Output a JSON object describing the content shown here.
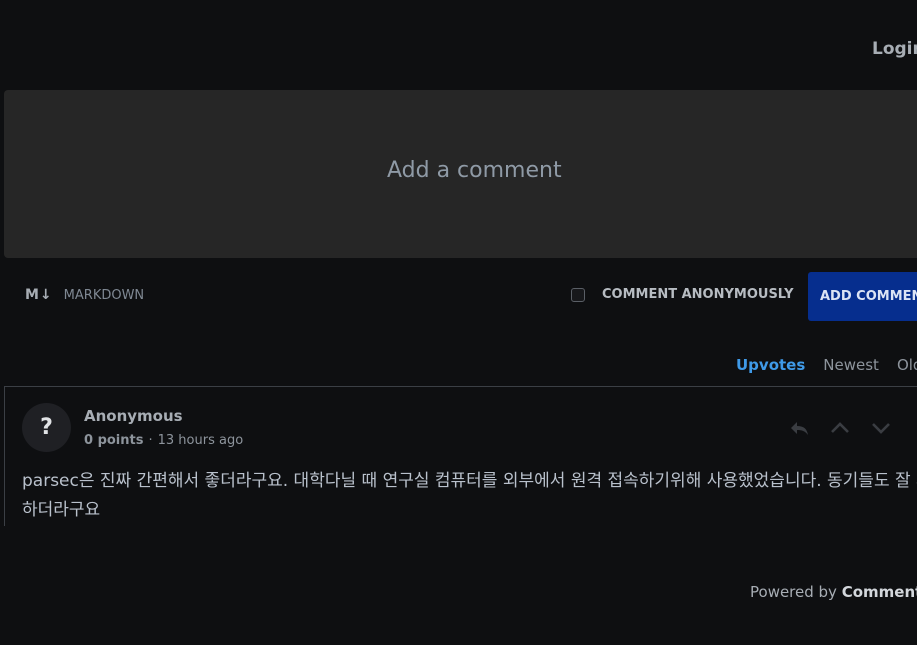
{
  "header": {
    "login_label": "Login"
  },
  "composer": {
    "placeholder": "Add a comment",
    "markdown_icon": "M↓",
    "markdown_label": "MARKDOWN",
    "anonymous_label": "COMMENT ANONYMOUSLY",
    "add_button_label": "ADD COMMENT"
  },
  "sort": {
    "options": [
      "Upvotes",
      "Newest",
      "Oldest"
    ],
    "active": "Upvotes"
  },
  "comments": [
    {
      "avatar": "?",
      "author": "Anonymous",
      "points": "0 points",
      "separator": "·",
      "time": "13 hours ago",
      "body": "parsec은 진짜 간편해서 좋더라구요. 대학다닐 때 연구실 컴퓨터를 외부에서 원격 접속하기위해 사용했었습니다. 동기들도 잘 사용하더라구요"
    }
  ],
  "footer": {
    "powered_prefix": "Powered by",
    "powered_brand": "Commento"
  },
  "colors": {
    "accent": "#3f9ae8",
    "button": "#062e8e",
    "background": "#0e0f11",
    "textarea": "#262626"
  },
  "icons": [
    "reply-icon",
    "upvote-icon",
    "downvote-icon"
  ]
}
